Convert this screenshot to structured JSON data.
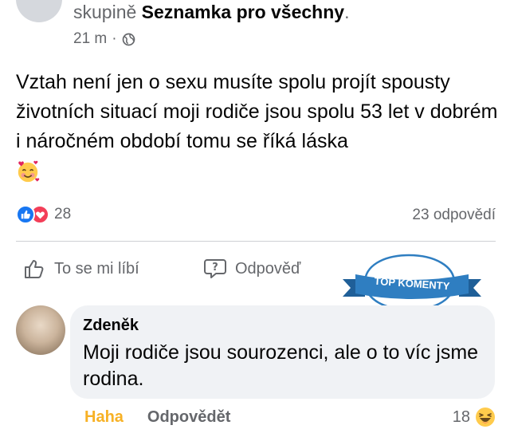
{
  "header": {
    "group_prefix": "skupině ",
    "group_name": "Seznamka pro všechny",
    "group_suffix": ".",
    "time": "21 m",
    "separator": "·",
    "privacy_icon": "globe-icon"
  },
  "post": {
    "text": "Vztah není jen o sexu musíte spolu projít spousty životních situací moji rodiče jsou spolu 53 let v dobrém i náročném období tomu se říká láska",
    "emoji": "smiling-face-with-hearts-icon"
  },
  "reactions": {
    "icons": [
      "like-icon",
      "love-icon"
    ],
    "count": "28",
    "replies": "23 odpovědí"
  },
  "actions": {
    "like_label": "To se mi líbí",
    "reply_label": "Odpověď"
  },
  "badge": {
    "label": "TOP KOMENTY"
  },
  "comment": {
    "author": "Zdeněk",
    "text": "Moji rodiče jsou sourozenci, ale o to víc jsme rodina.",
    "haha_label": "Haha",
    "reply_label": "Odpovědět",
    "reaction_count": "18",
    "reaction_icon": "laughing-face-icon"
  },
  "colors": {
    "brand_blue": "#1877f2",
    "love_red": "#f33e58",
    "haha_yellow": "#f7b125",
    "ribbon_blue": "#2f7ec1",
    "muted_text": "#65676b",
    "bubble_bg": "#f0f2f5"
  }
}
